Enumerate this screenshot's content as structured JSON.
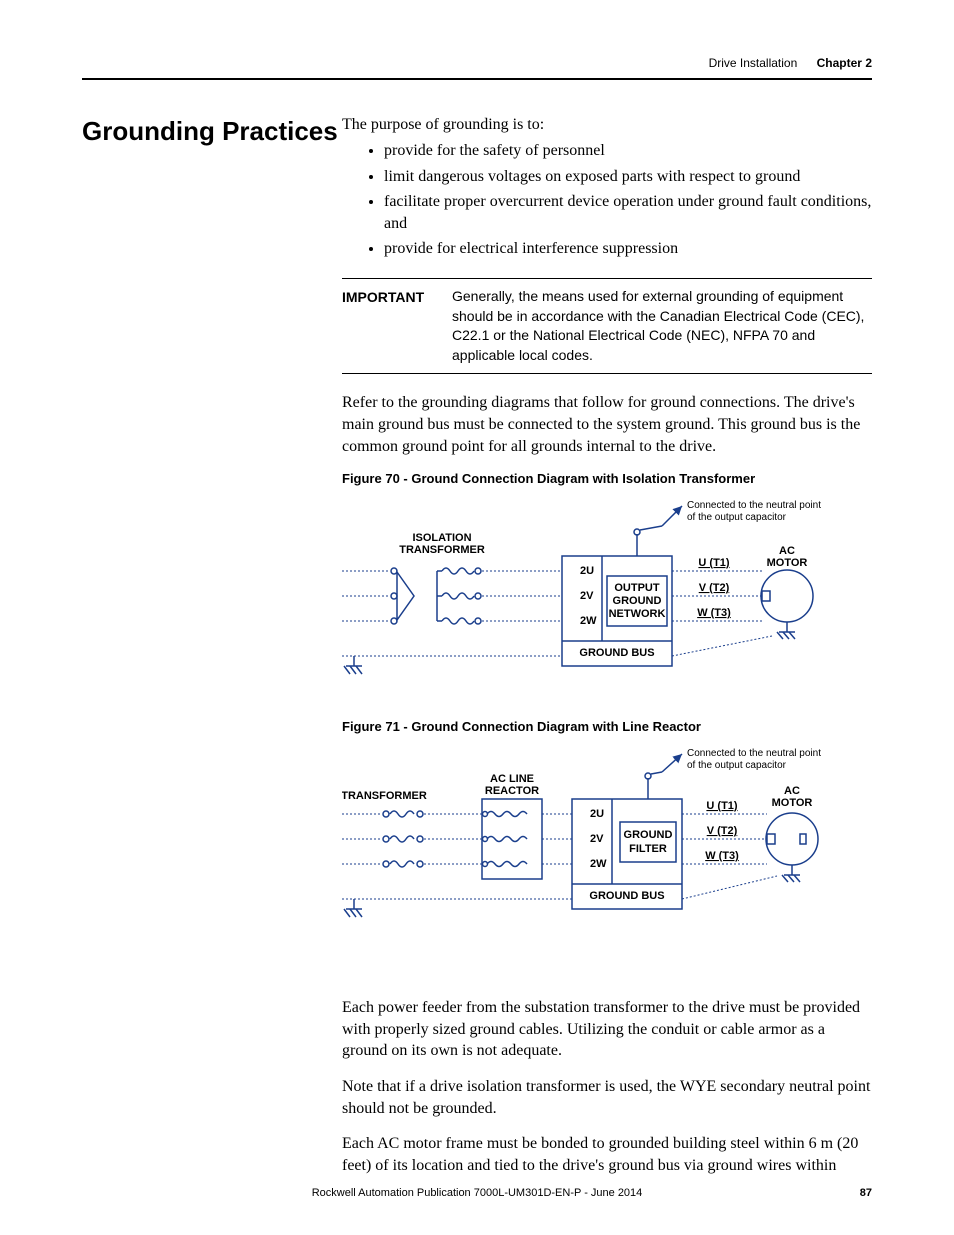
{
  "header": {
    "section": "Drive Installation",
    "chapter": "Chapter 2"
  },
  "sectionTitle": "Grounding Practices",
  "intro": "The purpose of grounding is to:",
  "bullets": [
    "provide for the safety of personnel",
    "limit dangerous voltages on exposed parts with respect to ground",
    "facilitate proper overcurrent device operation under ground fault conditions, and",
    "provide for electrical interference suppression"
  ],
  "important": {
    "label": "IMPORTANT",
    "text": "Generally, the means used for external grounding of equipment should be in accordance with the Canadian Electrical Code (CEC), C22.1 or the National Electrical Code (NEC), NFPA 70 and applicable local codes."
  },
  "para1": "Refer to the grounding diagrams that follow for ground connections. The drive's main ground bus must be connected to the system ground. This ground bus is the common ground point for all grounds internal to the drive.",
  "fig70": {
    "caption": "Figure 70 - Ground Connection Diagram with Isolation Transformer",
    "labels": {
      "iso": "ISOLATION\nTRANSFORMER",
      "ogn1": "OUTPUT",
      "ogn2": "GROUND",
      "ogn3": "NETWORK",
      "gbus": "GROUND BUS",
      "u": "2U",
      "v": "2V",
      "w": "2W",
      "t1": "U (T1)",
      "t2": "V (T2)",
      "t3": "W (T3)",
      "mot": "AC\nMOTOR",
      "note": "Connected to the neutral point\nof the output capacitor"
    }
  },
  "fig71": {
    "caption": "Figure 71 - Ground Connection Diagram with Line Reactor",
    "labels": {
      "trans": "TRANSFORMER",
      "react": "AC LINE\nREACTOR",
      "gf1": "GROUND",
      "gf2": "FILTER",
      "gbus": "GROUND BUS",
      "u": "2U",
      "v": "2V",
      "w": "2W",
      "t1": "U (T1)",
      "t2": "V (T2)",
      "t3": "W (T3)",
      "mot": "AC\nMOTOR",
      "note": "Connected to the neutral point\nof the output capacitor"
    }
  },
  "para2": "Each power feeder from the substation transformer to the drive must be provided with properly sized ground cables. Utilizing the conduit or cable armor as a ground on its own is not adequate.",
  "para3": "Note that if a drive isolation transformer is used, the WYE secondary neutral point should not be grounded.",
  "para4": "Each AC motor frame must be bonded to grounded building steel within 6 m (20 feet) of its location and tied to the drive's ground bus via ground wires within",
  "footer": {
    "pub": "Rockwell Automation Publication 7000L-UM301D-EN-P - June 2014",
    "page": "87"
  }
}
